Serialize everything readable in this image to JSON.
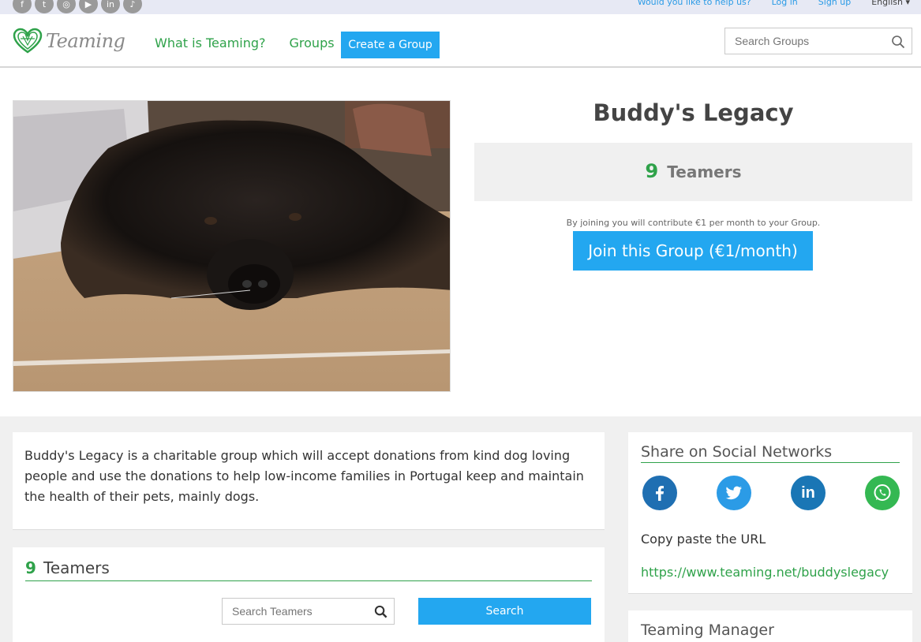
{
  "topbar": {
    "social_icons": [
      "facebook-icon",
      "twitter-icon",
      "instagram-icon",
      "youtube-icon",
      "linkedin-icon",
      "tiktok-icon"
    ],
    "help_link": "Would you like to help us?",
    "login_link": "Log in",
    "signup_link": "Sign up",
    "language": "English"
  },
  "header": {
    "logo_text": "Teaming",
    "nav": {
      "what_is": "What is Teaming?",
      "groups": "Groups"
    },
    "create_button": "Create a Group",
    "search_placeholder": "Search Groups"
  },
  "group": {
    "title": "Buddy's Legacy",
    "teamers_count": "9",
    "teamers_label": "Teamers",
    "contribution_note": "By joining you will contribute €1 per month to your Group.",
    "join_button": "Join this Group (€1/month)",
    "description": "Buddy's Legacy is a charitable group which will accept donations from kind dog loving people and use the donations to help low-income families in Portugal keep and maintain the health of their pets, mainly dogs."
  },
  "teamers_section": {
    "count": "9",
    "label": "Teamers",
    "search_placeholder": "Search Teamers",
    "search_button": "Search"
  },
  "share": {
    "title": "Share on Social Networks",
    "networks": [
      "facebook",
      "twitter",
      "linkedin",
      "whatsapp"
    ],
    "copy_label": "Copy paste the URL",
    "url": "https://www.teaming.net/buddyslegacy"
  },
  "manager": {
    "title": "Teaming Manager"
  },
  "colors": {
    "brand_green": "#2fa24a",
    "button_blue": "#23a7f0",
    "facebook": "#1f6fb2",
    "twitter": "#2b9be6",
    "linkedin": "#1a76b5",
    "whatsapp": "#34b852"
  }
}
